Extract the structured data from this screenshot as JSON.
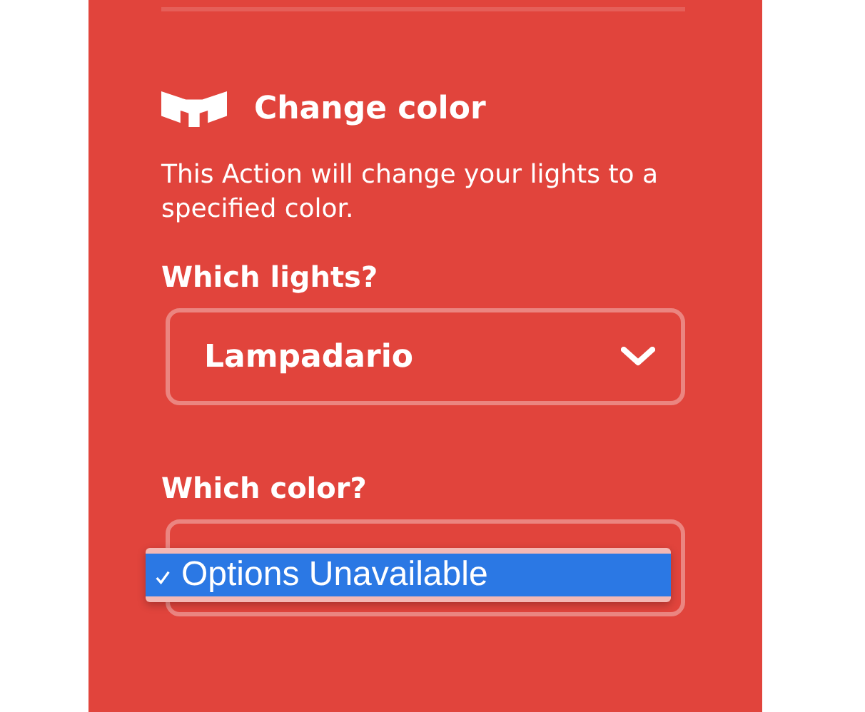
{
  "action": {
    "title": "Change color",
    "description": "This Action will change your lights to a specified color."
  },
  "fields": [
    {
      "label": "Which lights?",
      "value": "Lampadario",
      "menu_open": false
    },
    {
      "label": "Which color?",
      "menu_open": true,
      "options": [
        {
          "label": "Options Unavailable",
          "selected": true
        }
      ]
    }
  ]
}
